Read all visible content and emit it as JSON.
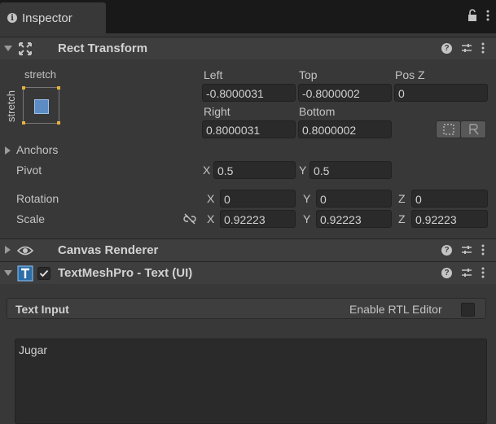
{
  "tab": {
    "title": "Inspector",
    "icon": "info-icon"
  },
  "rect_transform": {
    "name": "Rect Transform",
    "anchor_preset": {
      "h_label": "stretch",
      "v_label": "stretch"
    },
    "left_label": "Left",
    "top_label": "Top",
    "posz_label": "Pos Z",
    "left": "-0.8000031",
    "top": "-0.8000002",
    "posz": "0",
    "right_label": "Right",
    "bottom_label": "Bottom",
    "right": "0.8000031",
    "bottom": "0.8000002",
    "anchors_label": "Anchors",
    "pivot_label": "Pivot",
    "pivot_x_axis": "X",
    "pivot_x": "0.5",
    "pivot_y_axis": "Y",
    "pivot_y": "0.5",
    "rotation_label": "Rotation",
    "rot_x_axis": "X",
    "rot_x": "0",
    "rot_y_axis": "Y",
    "rot_y": "0",
    "rot_z_axis": "Z",
    "rot_z": "0",
    "scale_label": "Scale",
    "scale_x_axis": "X",
    "scale_x": "0.92223",
    "scale_y_axis": "Y",
    "scale_y": "0.92223",
    "scale_z_axis": "Z",
    "scale_z": "0.92223"
  },
  "canvas_renderer": {
    "name": "Canvas Renderer"
  },
  "textmeshpro": {
    "name": "TextMeshPro - Text (UI)",
    "enabled": true
  },
  "text_input": {
    "section_label": "Text Input",
    "rtl_label": "Enable RTL Editor",
    "value": "Jugar"
  }
}
